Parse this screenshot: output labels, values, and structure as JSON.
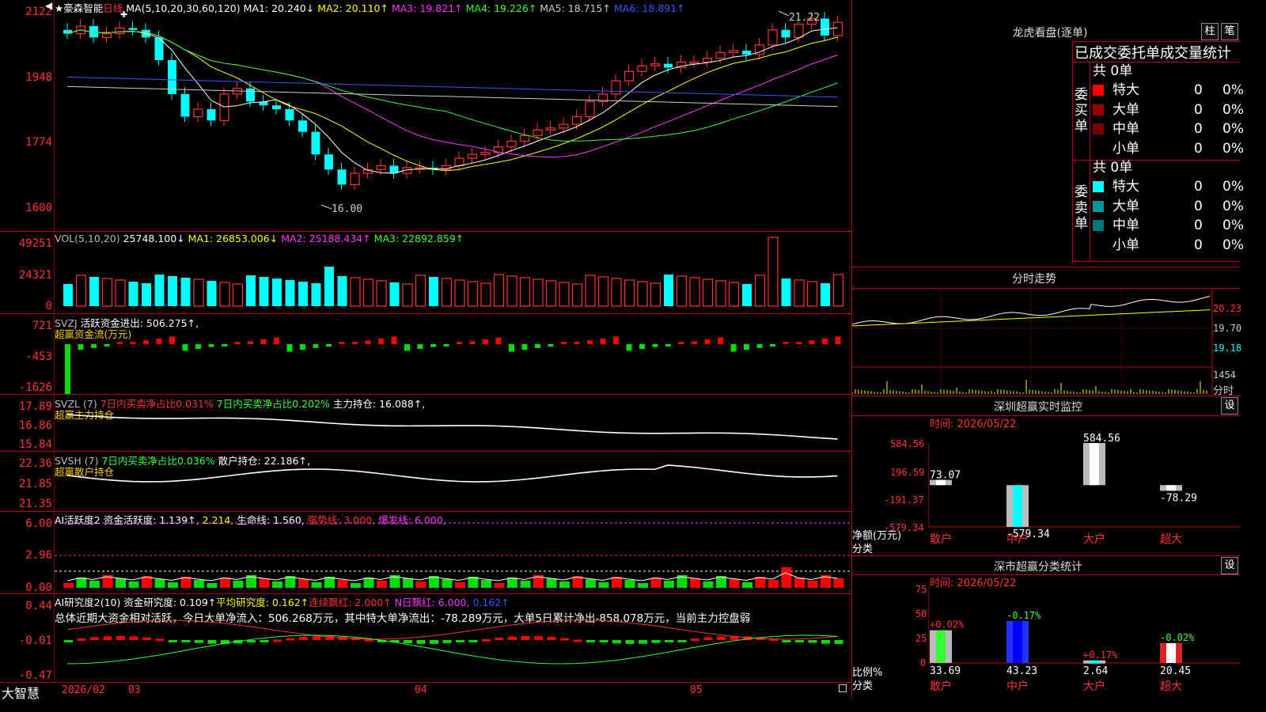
{
  "stock": {
    "star": "★",
    "name": "豪森智能",
    "period": "日线"
  },
  "main_axis": [
    "2122",
    "1948",
    "1774",
    "1600"
  ],
  "ma_line": {
    "label": "MA(5,10,20,30,60,120)",
    "items": [
      {
        "t": "MA1: 20.240↓",
        "c": "#ffffff"
      },
      {
        "t": "MA2: 20.110↑",
        "c": "#ffff00"
      },
      {
        "t": "MA3: 19.821↑",
        "c": "#ff33ff"
      },
      {
        "t": "MA4: 19.226↑",
        "c": "#33ff33"
      },
      {
        "t": "MA5: 18.715↑",
        "c": "#cccccc"
      },
      {
        "t": "MA6: 18.891↑",
        "c": "#3355ff"
      }
    ]
  },
  "price_marks": {
    "high": "21.22",
    "low": "16.00"
  },
  "vol": {
    "axis": [
      "49251",
      "24321",
      "0"
    ],
    "label": "VOL(5,10,20)",
    "value": "25748.100↓",
    "ma1": "MA1: 26853.006↓",
    "ma2": "MA2: 25188.434↑",
    "ma3": "MA3: 22892.859↑"
  },
  "svzj": {
    "axis": [
      "721",
      "-453",
      "-1626"
    ],
    "label": "SVZJ",
    "value": "活跃资金进出: 506.275↑,",
    "sub": "超赢资金流(万元)"
  },
  "svzl": {
    "axis": [
      "17.89",
      "16.86",
      "15.84"
    ],
    "label": "SVZL (7)",
    "t1": "7日内买卖净占比0.031%",
    "t2": "7日内买卖净占比0.202%",
    "t3": "主力持仓: 16.088↑,",
    "sub": "超赢主力持仓"
  },
  "svsh": {
    "axis": [
      "22.36",
      "21.85",
      "21.35"
    ],
    "label": "SVSH (7)",
    "t1": "7日内买卖净占比0.036%",
    "t2": "散户持仓: 22.186↑,",
    "sub": "超赢散户持仓"
  },
  "ai_act": {
    "axis": [
      "6.00",
      "2.96",
      "0.00"
    ],
    "label": "AI活跃度2",
    "t1": "资金活跃度: 1.139↑",
    "t2": ", 2.214,",
    "t3": "生命线: 1.560,",
    "t4": "强势线: 3.000,",
    "t5": "爆发线: 6.000,"
  },
  "ai_res": {
    "axis": [
      "0.44",
      "-0.01",
      "-0.47"
    ],
    "label": "AI研究度2(10)",
    "t1": "资金研究度: 0.109↑",
    "t2": "平均研究度: 0.162↑",
    "t3": "连续飘红: 2.000↑",
    "t4": "N日飘红: 6.000,",
    "t5": "0.162↑",
    "summary": "总体近期大资金相对活跃，今日大单净流入：506.268万元，其中特大单净流出：-78.289万元，大单5日累计净出-858.078万元，当前主力控盘弱"
  },
  "bottom": {
    "brand": "大智慧",
    "dates": [
      "2026/02",
      "03",
      "04",
      "05"
    ]
  },
  "lhb": {
    "title": "龙虎看盘(逐单)",
    "btn1": "柱",
    "btn2": "笔",
    "header": "已成交委托单成交量统计",
    "buy_total": "共 0单",
    "buy_side": "委买单",
    "buy_rows": [
      {
        "n": "特大",
        "v": "0",
        "p": "0%",
        "c": "#ff0000"
      },
      {
        "n": "大单",
        "v": "0",
        "p": "0%",
        "c": "#990000"
      },
      {
        "n": "中单",
        "v": "0",
        "p": "0%",
        "c": "#770000"
      },
      {
        "n": "小单",
        "v": "0",
        "p": "0%",
        "c": ""
      }
    ],
    "sell_total": "共 0单",
    "sell_side": "委卖单",
    "sell_rows": [
      {
        "n": "特大",
        "v": "0",
        "p": "0%",
        "c": "#00ffff"
      },
      {
        "n": "大单",
        "v": "0",
        "p": "0%",
        "c": "#009999"
      },
      {
        "n": "中单",
        "v": "0",
        "p": "0%",
        "c": "#007777"
      },
      {
        "n": "小单",
        "v": "0",
        "p": "0%",
        "c": ""
      }
    ]
  },
  "fenshi": {
    "title": "分时走势",
    "axis": [
      "20.23",
      "19.70",
      "19.18",
      "1454"
    ],
    "label": "分时"
  },
  "sz_monitor": {
    "title": "深圳超赢实时监控",
    "btn": "设",
    "time": "时间: 2026/05/22",
    "axis": [
      "584.56",
      "196.59",
      "-191.37",
      "-579.34"
    ],
    "ylab1": "净额(万元)",
    "ylab2": "分类",
    "chart_data": {
      "type": "bar",
      "categories": [
        "散户",
        "中户",
        "大户",
        "超大"
      ],
      "values": [
        73.07,
        -579.34,
        584.56,
        -78.29
      ],
      "value_labels": [
        "73.07",
        "-579.34",
        "584.56",
        "-78.29"
      ],
      "ylim": [
        -579.34,
        584.56
      ]
    }
  },
  "sz_class": {
    "title": "深市超赢分类统计",
    "btn": "设",
    "time": "时间: 2026/05/22",
    "axis": [
      "75",
      "50",
      "25",
      "0"
    ],
    "ylab1": "比例%",
    "ylab2": "分类",
    "chart_data": {
      "type": "bar",
      "categories": [
        "散户",
        "中户",
        "大户",
        "超大"
      ],
      "values": [
        33.69,
        43.23,
        2.64,
        20.45
      ],
      "value_labels": [
        "33.69",
        "43.23",
        "2.64",
        "20.45"
      ],
      "change_labels": [
        "+0.02%",
        "-0.17%",
        "+0.17%",
        "-0.02%"
      ],
      "ylim": [
        0,
        75
      ]
    }
  }
}
